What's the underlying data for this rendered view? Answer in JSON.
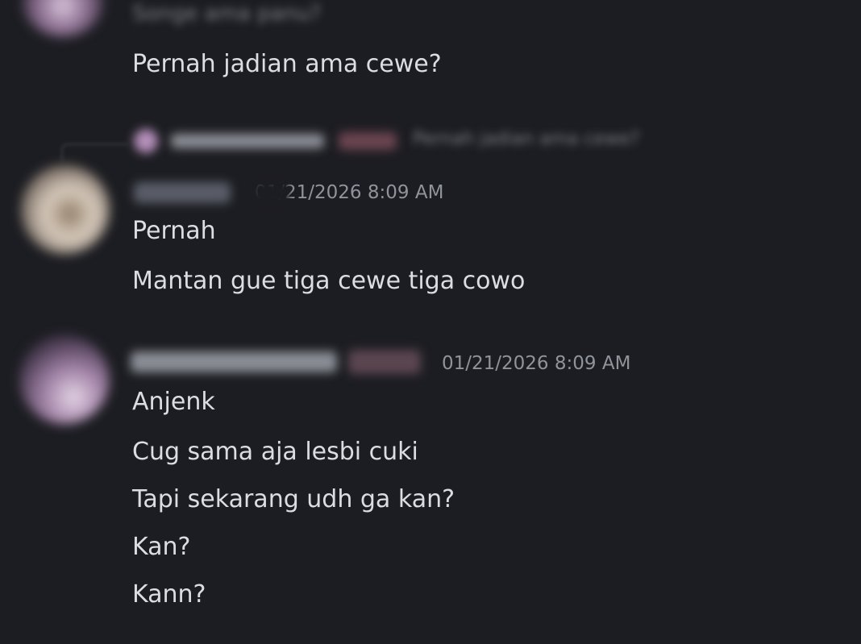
{
  "messages": {
    "top_partial_line": "Songe ama panu?",
    "msg1": "Pernah jadian ama cewe?",
    "reply_preview": "Pernah jadian ama cewe?",
    "group2": {
      "timestamp": "01/21/2026 8:09 AM",
      "lines": [
        "Pernah",
        "Mantan gue tiga cewe tiga cowo"
      ]
    },
    "group3": {
      "timestamp": "01/21/2026 8:09 AM",
      "lines": [
        "Anjenk",
        "Cug sama aja lesbi cuki",
        "Tapi sekarang udh ga kan?",
        "Kan?",
        "Kann?"
      ]
    }
  },
  "colors": {
    "background": "#1c1d22",
    "message_text": "#dcdde1",
    "timestamp_text": "#8f939b"
  }
}
